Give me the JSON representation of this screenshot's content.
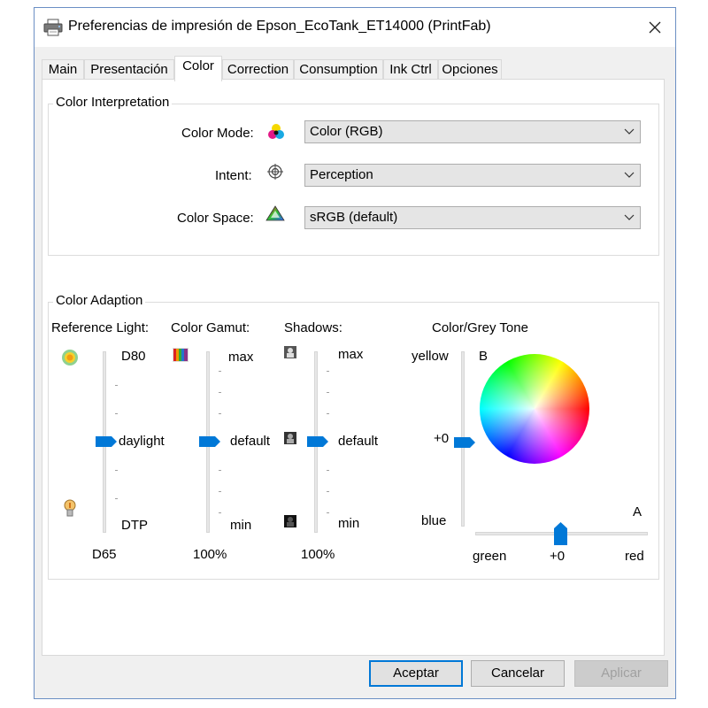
{
  "window": {
    "title": "Preferencias de impresión de Epson_EcoTank_ET14000 (PrintFab)"
  },
  "tabs": [
    {
      "label": "Main"
    },
    {
      "label": "Presentación"
    },
    {
      "label": "Color",
      "active": true
    },
    {
      "label": "Correction"
    },
    {
      "label": "Consumption"
    },
    {
      "label": "Ink Ctrl"
    },
    {
      "label": "Opciones"
    }
  ],
  "interpretation": {
    "group_label": "Color Interpretation",
    "color_mode": {
      "label": "Color Mode:",
      "value": "Color (RGB)",
      "icon": "color-mode-icon"
    },
    "intent": {
      "label": "Intent:",
      "value": "Perception",
      "icon": "crosshair-icon"
    },
    "color_space": {
      "label": "Color Space:",
      "value": "sRGB (default)",
      "icon": "gamut-triangle-icon"
    }
  },
  "adaption": {
    "group_label": "Color Adaption",
    "reference_light": {
      "label": "Reference Light:",
      "top": "D80",
      "middle": "daylight",
      "bottom": "DTP",
      "value": "D65",
      "position": 0.5
    },
    "color_gamut": {
      "label": "Color Gamut:",
      "top": "max",
      "middle": "default",
      "bottom": "min",
      "value": "100%",
      "position": 0.5
    },
    "shadows": {
      "label": "Shadows:",
      "top": "max",
      "middle": "default",
      "bottom": "min",
      "value": "100%",
      "position": 0.5
    },
    "grey_tone": {
      "label": "Color/Grey Tone",
      "yellow": "yellow",
      "blue": "blue",
      "b_axis": "B",
      "b_value": "+0",
      "a_axis": "A",
      "green": "green",
      "red": "red",
      "a_value": "+0"
    }
  },
  "buttons": {
    "ok": "Aceptar",
    "cancel": "Cancelar",
    "apply": "Aplicar"
  },
  "colors": {
    "accent": "#0078d7",
    "frame": "#6b8fc4"
  }
}
